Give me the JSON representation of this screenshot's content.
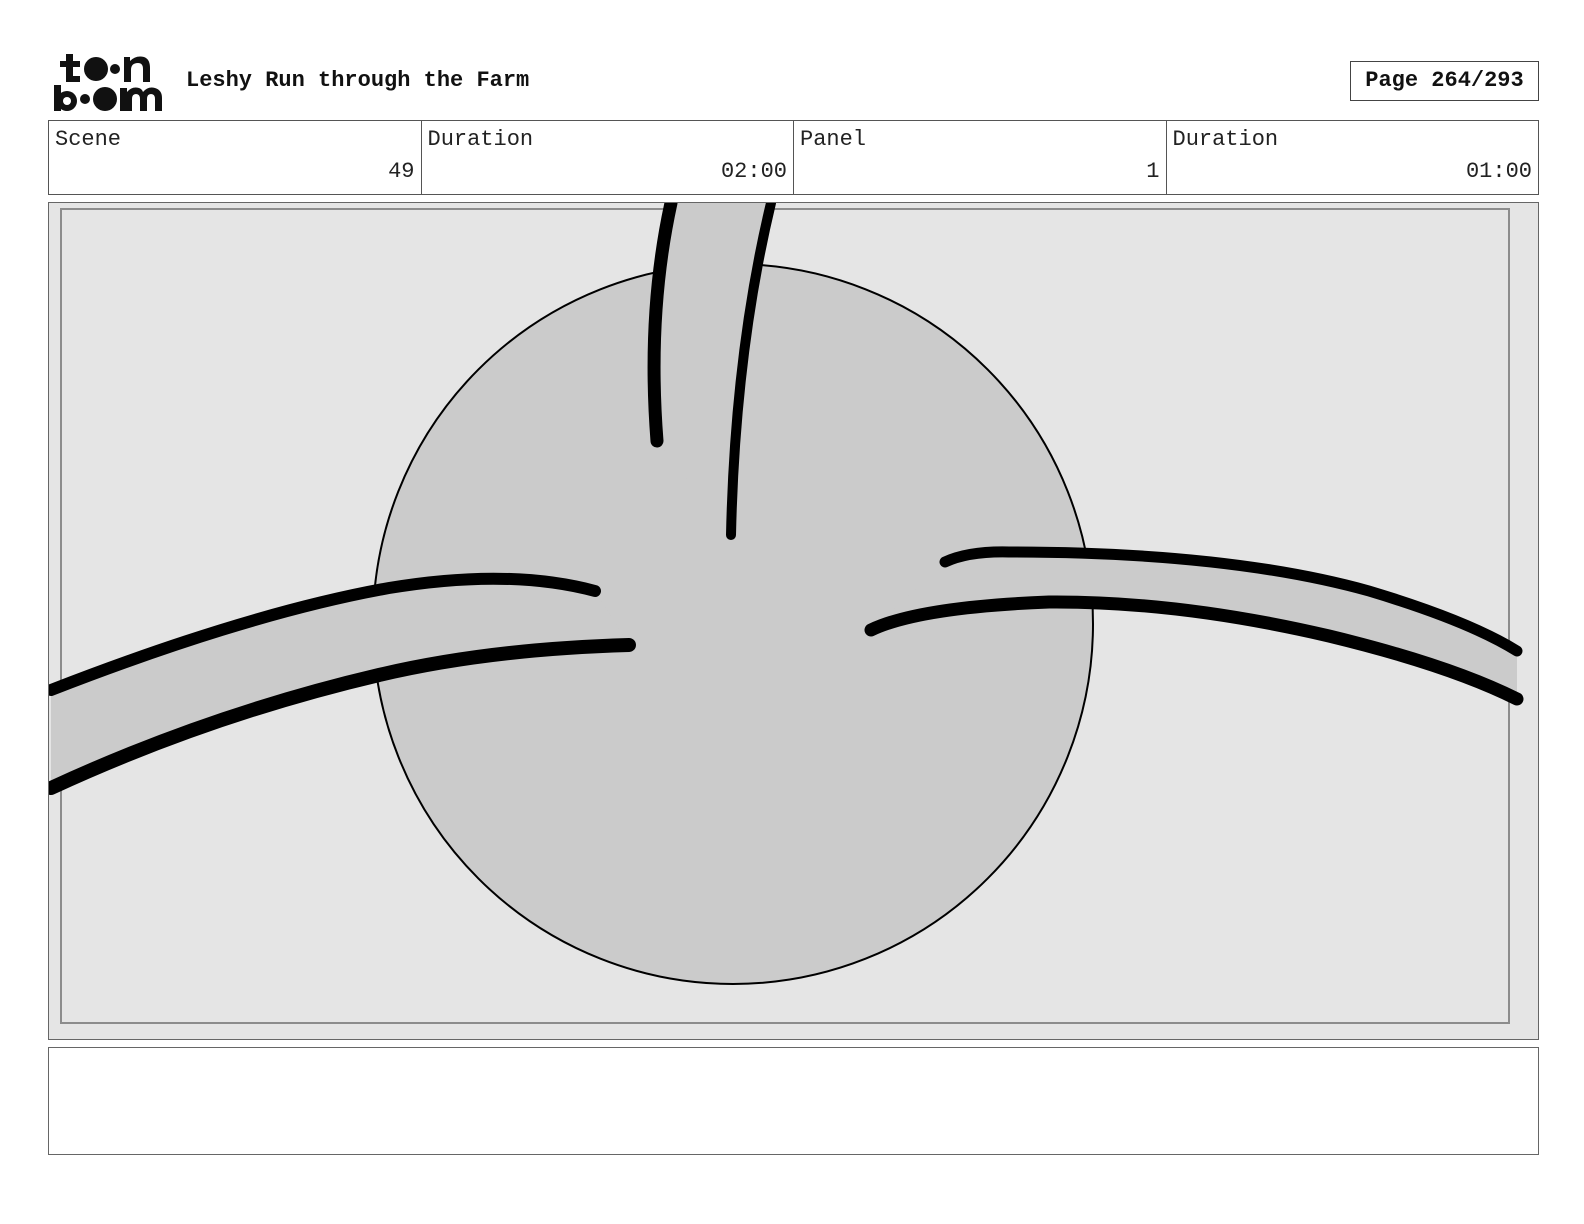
{
  "header": {
    "logo_text_top": "toon",
    "logo_text_bottom": "boom",
    "project_title": "Leshy Run through the Farm",
    "page_indicator": "Page 264/293"
  },
  "info": {
    "scene_label": "Scene",
    "scene_value": "49",
    "scene_duration_label": "Duration",
    "scene_duration_value": "02:00",
    "panel_label": "Panel",
    "panel_value": "1",
    "panel_duration_label": "Duration",
    "panel_duration_value": "01:00"
  },
  "panel_art": {
    "background_color": "#e5e5e5",
    "circle_fill": "#cbcbcb",
    "stroke_color": "#000000"
  },
  "notes": {
    "text": ""
  }
}
